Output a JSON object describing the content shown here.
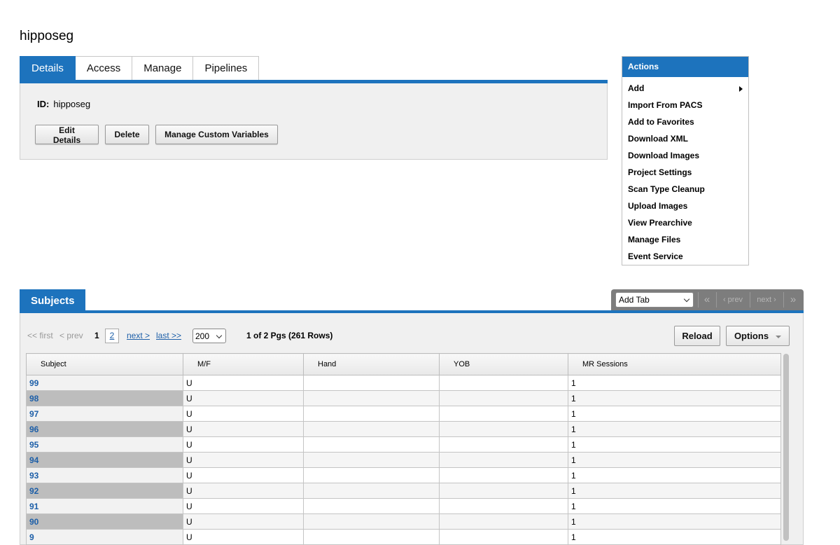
{
  "project": {
    "title": "hipposeg"
  },
  "tabs": [
    {
      "label": "Details",
      "active": true
    },
    {
      "label": "Access",
      "active": false
    },
    {
      "label": "Manage",
      "active": false
    },
    {
      "label": "Pipelines",
      "active": false
    }
  ],
  "details": {
    "id_label": "ID:",
    "id_value": "hipposeg",
    "buttons": {
      "edit": "Edit Details",
      "delete": "Delete",
      "custom_vars": "Manage Custom Variables"
    }
  },
  "actions": {
    "title": "Actions",
    "items": [
      "Add",
      "Import From PACS",
      "Add to Favorites",
      "Download XML",
      "Download Images",
      "Project Settings",
      "Scan Type Cleanup",
      "Upload Images",
      "View Prearchive",
      "Manage Files",
      "Event Service"
    ]
  },
  "subjects": {
    "tab_label": "Subjects",
    "add_tab": "Add Tab",
    "tab_nav": {
      "first": "«",
      "prev": "‹ prev",
      "next": "next ›",
      "last": "»"
    },
    "pager": {
      "first": "<< first",
      "prev": "< prev",
      "current": "1",
      "page2": "2",
      "next": "next >",
      "last": "last >>",
      "page_size": "200",
      "info": "1 of 2 Pgs (261 Rows)"
    },
    "reload": "Reload",
    "options": "Options",
    "columns": [
      "Subject",
      "M/F",
      "Hand",
      "YOB",
      "MR Sessions"
    ],
    "rows": [
      [
        "99",
        "U",
        "",
        "",
        "1"
      ],
      [
        "98",
        "U",
        "",
        "",
        "1"
      ],
      [
        "97",
        "U",
        "",
        "",
        "1"
      ],
      [
        "96",
        "U",
        "",
        "",
        "1"
      ],
      [
        "95",
        "U",
        "",
        "",
        "1"
      ],
      [
        "94",
        "U",
        "",
        "",
        "1"
      ],
      [
        "93",
        "U",
        "",
        "",
        "1"
      ],
      [
        "92",
        "U",
        "",
        "",
        "1"
      ],
      [
        "91",
        "U",
        "",
        "",
        "1"
      ],
      [
        "90",
        "U",
        "",
        "",
        "1"
      ],
      [
        "9",
        "U",
        "",
        "",
        "1"
      ]
    ]
  },
  "colors": {
    "accent": "#1d73bd",
    "link": "#1d5fa8"
  }
}
